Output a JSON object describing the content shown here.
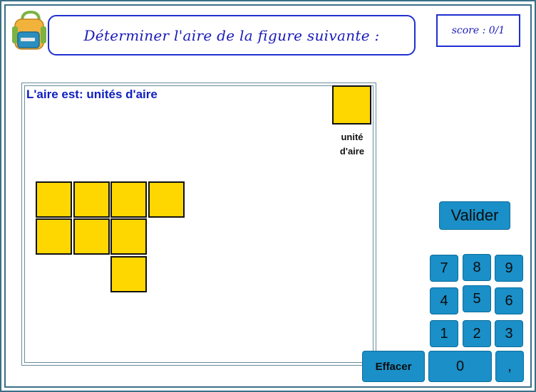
{
  "header": {
    "title": "Déterminer l'aire de la figure suivante :",
    "score": "score : 0/1"
  },
  "work": {
    "answer_label": "L'aire est:",
    "answer_unit": "unités d'aire",
    "unit_caption_line1": "unité",
    "unit_caption_line2": "d'aire",
    "unit_color": "#ffd700"
  },
  "keypad": {
    "validate_label": "Valider",
    "clear_label": "Effacer",
    "keys": [
      "7",
      "8",
      "9",
      "4",
      "5",
      "6",
      "1",
      "2",
      "3",
      "0",
      ","
    ]
  },
  "colors": {
    "accent": "#1a8fc8",
    "title": "#1a1ab8",
    "frame": "#3a6f86"
  }
}
